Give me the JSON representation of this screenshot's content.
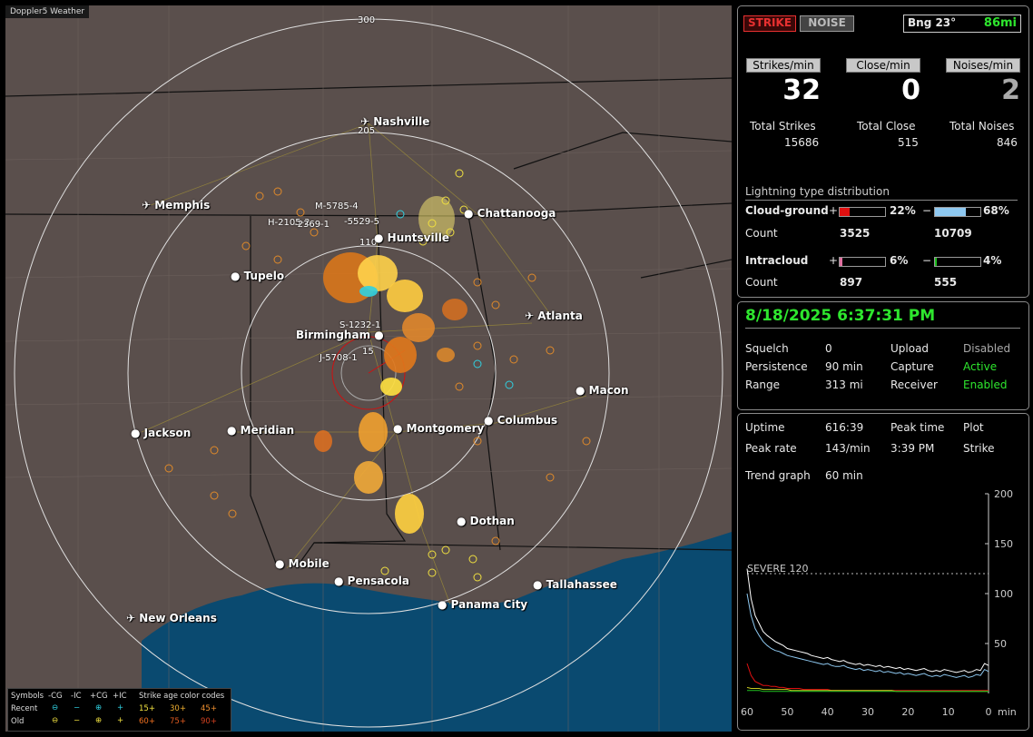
{
  "map": {
    "title": "Doppler5 Weather",
    "range_labels": [
      "300",
      "205",
      "110",
      "15"
    ],
    "cities": [
      {
        "id": "nashville",
        "name": "Nashville",
        "airport": true
      },
      {
        "id": "memphis",
        "name": "Memphis",
        "airport": true
      },
      {
        "id": "chattanooga",
        "name": "Chattanooga",
        "airport": false
      },
      {
        "id": "huntsville",
        "name": "Huntsville",
        "airport": false
      },
      {
        "id": "tupelo",
        "name": "Tupelo",
        "airport": false
      },
      {
        "id": "atlanta",
        "name": "Atlanta",
        "airport": true
      },
      {
        "id": "birmingham",
        "name": "Birmingham",
        "airport": false
      },
      {
        "id": "macon",
        "name": "Macon",
        "airport": false
      },
      {
        "id": "jackson",
        "name": "Jackson",
        "airport": false
      },
      {
        "id": "meridian",
        "name": "Meridian",
        "airport": false
      },
      {
        "id": "montgomery",
        "name": "Montgomery",
        "airport": false
      },
      {
        "id": "columbus",
        "name": "Columbus",
        "airport": false
      },
      {
        "id": "dothan",
        "name": "Dothan",
        "airport": false
      },
      {
        "id": "mobile",
        "name": "Mobile",
        "airport": false
      },
      {
        "id": "pensacola",
        "name": "Pensacola",
        "airport": false
      },
      {
        "id": "tallahassee",
        "name": "Tallahassee",
        "airport": false
      },
      {
        "id": "panama_city",
        "name": "Panama City",
        "airport": false
      },
      {
        "id": "new_orleans",
        "name": "New Orleans",
        "airport": true
      }
    ],
    "storm_labels": [
      "M-5785-4",
      "H-2105-2",
      "-2369-1",
      "-5529-5",
      "S-1232-1",
      "J-5708-1"
    ],
    "legend": {
      "symbols_label": "Symbols",
      "cols": [
        "-CG",
        "-IC",
        "+CG",
        "+IC"
      ],
      "recent": "Recent",
      "old": "Old",
      "age_title": "Strike age color codes",
      "recent_ages": [
        "15+",
        "30+",
        "45+"
      ],
      "old_ages": [
        "60+",
        "75+",
        "90+"
      ]
    }
  },
  "status": {
    "strike_btn": "STRIKE",
    "noise_btn": "NOISE",
    "bearing": "Bng 23°",
    "distance": "86mi",
    "strikes_per_min_label": "Strikes/min",
    "close_per_min_label": "Close/min",
    "noises_per_min_label": "Noises/min",
    "strikes_per_min": "32",
    "close_per_min": "0",
    "noises_per_min": "2",
    "total_strikes_label": "Total Strikes",
    "total_close_label": "Total Close",
    "total_noises_label": "Total Noises",
    "total_strikes": "15686",
    "total_close": "515",
    "total_noises": "846",
    "dist_title": "Lightning type distribution",
    "cg_label": "Cloud-ground",
    "ic_label": "Intracloud",
    "count_label": "Count",
    "plus": "+",
    "minus": "−",
    "cg_pos_pct": "22%",
    "cg_neg_pct": "68%",
    "cg_pos_count": "3525",
    "cg_neg_count": "10709",
    "ic_pos_pct": "6%",
    "ic_neg_pct": "4%",
    "ic_pos_count": "897",
    "ic_neg_count": "555",
    "cg_pos_frac": 0.22,
    "cg_neg_frac": 0.68,
    "ic_pos_frac": 0.06,
    "ic_neg_frac": 0.04,
    "colors": {
      "cg_pos": "#e01010",
      "cg_neg": "#8ec8f0",
      "ic_pos": "#e070a0",
      "ic_neg": "#20c020"
    }
  },
  "settings": {
    "datetime": "8/18/2025 6:37:31 PM",
    "squelch_label": "Squelch",
    "squelch": "0",
    "persistence_label": "Persistence",
    "persistence": "90 min",
    "range_label": "Range",
    "range": "313 mi",
    "upload_label": "Upload",
    "upload": "Disabled",
    "capture_label": "Capture",
    "capture": "Active",
    "receiver_label": "Receiver",
    "receiver": "Enabled"
  },
  "stats": {
    "uptime_label": "Uptime",
    "uptime": "616:39",
    "peak_time_label": "Peak time",
    "peak_time": "3:39 PM",
    "plot_label": "Plot",
    "plot": "Strike",
    "peak_rate_label": "Peak rate",
    "peak_rate": "143/min",
    "trend_label": "Trend graph",
    "trend": "60 min"
  },
  "chart_data": {
    "type": "line",
    "x_direction": "minutes ago",
    "xlim": [
      60,
      0
    ],
    "ylim": [
      0,
      200
    ],
    "x_ticks": [
      "60",
      "50",
      "40",
      "30",
      "20",
      "10",
      "0"
    ],
    "y_ticks": [
      "200",
      "150",
      "100",
      "50"
    ],
    "xlabel": "min",
    "severe_label": "SEVERE 120",
    "severe_value": 120,
    "series": [
      {
        "color": "#ffffff",
        "values": [
          125,
          95,
          78,
          70,
          62,
          58,
          55,
          52,
          50,
          48,
          45,
          44,
          43,
          42,
          41,
          40,
          38,
          37,
          36,
          35,
          36,
          34,
          33,
          32,
          33,
          31,
          30,
          29,
          30,
          28,
          29,
          28,
          27,
          28,
          26,
          27,
          26,
          25,
          26,
          24,
          25,
          24,
          23,
          24,
          25,
          23,
          22,
          23,
          22,
          24,
          23,
          22,
          21,
          22,
          23,
          21,
          22,
          24,
          23,
          30,
          28
        ]
      },
      {
        "color": "#8ec8f0",
        "values": [
          100,
          78,
          65,
          58,
          52,
          48,
          45,
          43,
          42,
          40,
          38,
          37,
          36,
          35,
          34,
          33,
          32,
          31,
          30,
          29,
          30,
          28,
          27,
          27,
          28,
          26,
          25,
          24,
          25,
          23,
          24,
          23,
          22,
          23,
          21,
          22,
          21,
          20,
          21,
          19,
          20,
          19,
          18,
          19,
          20,
          18,
          17,
          18,
          17,
          19,
          18,
          17,
          16,
          17,
          18,
          16,
          17,
          19,
          18,
          24,
          22
        ]
      },
      {
        "color": "#e01010",
        "values": [
          30,
          18,
          12,
          10,
          8,
          8,
          7,
          7,
          6,
          6,
          5,
          5,
          5,
          5,
          4,
          4,
          4,
          4,
          4,
          4,
          4,
          3,
          3,
          3,
          3,
          3,
          3,
          3,
          3,
          3,
          3,
          3,
          3,
          3,
          3,
          3,
          3,
          3,
          3,
          3,
          3,
          3,
          3,
          3,
          3,
          3,
          3,
          3,
          3,
          3,
          3,
          3,
          3,
          3,
          3,
          3,
          3,
          3,
          3,
          3,
          3
        ]
      },
      {
        "color": "#c8c820",
        "values": [
          6,
          5,
          5,
          5,
          4,
          4,
          4,
          4,
          4,
          4,
          4,
          3,
          3,
          3,
          3,
          3,
          3,
          3,
          3,
          3,
          3,
          3,
          3,
          3,
          3,
          3,
          3,
          3,
          3,
          3,
          3,
          3,
          3,
          3,
          3,
          3,
          3,
          2,
          2,
          2,
          2,
          2,
          2,
          2,
          2,
          2,
          2,
          2,
          2,
          2,
          2,
          2,
          2,
          2,
          2,
          2,
          2,
          2,
          2,
          2,
          2
        ]
      },
      {
        "color": "#20c020",
        "values": [
          3,
          3,
          3,
          3,
          2,
          2,
          2,
          2,
          2,
          2,
          2,
          2,
          2,
          2,
          2,
          2,
          2,
          2,
          2,
          2,
          2,
          2,
          2,
          2,
          2,
          2,
          2,
          2,
          2,
          2,
          2,
          2,
          2,
          2,
          2,
          2,
          2,
          2,
          2,
          2,
          2,
          2,
          2,
          2,
          2,
          2,
          2,
          2,
          2,
          2,
          2,
          2,
          2,
          2,
          2,
          2,
          2,
          2,
          2,
          2,
          2
        ]
      }
    ]
  }
}
